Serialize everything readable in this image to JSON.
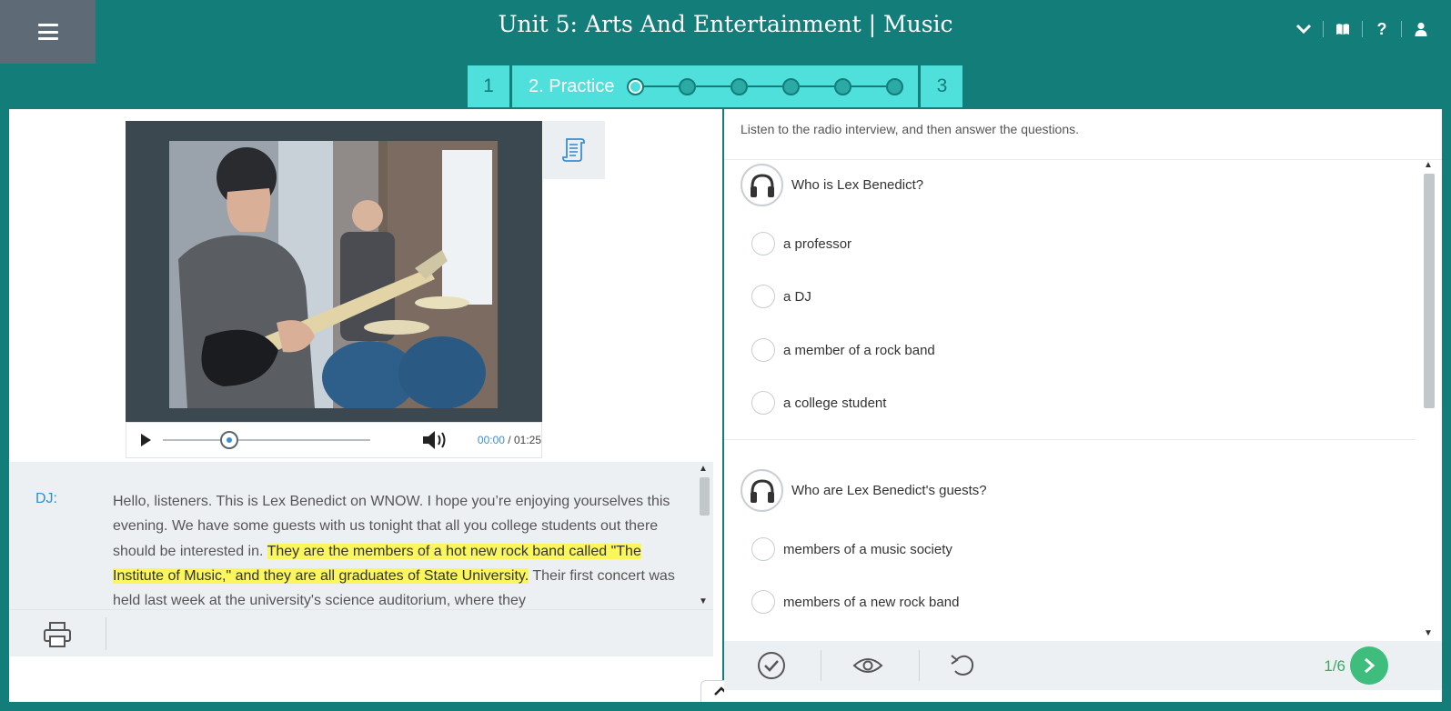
{
  "header": {
    "title": "Unit 5: Arts And Entertainment | Music",
    "icons": [
      "menu-icon",
      "chevron-down-icon",
      "book-icon",
      "help-icon",
      "user-icon"
    ],
    "help_glyph": "?"
  },
  "steps": {
    "first": "1",
    "active_label": "2. Practice",
    "last": "3",
    "dot_count": 6,
    "current_dot": 1
  },
  "media": {
    "time_current": "00:00",
    "time_separator": "/",
    "time_total": "01:25",
    "progress_fraction": 0.32
  },
  "transcript": {
    "speaker": "DJ:",
    "text_before": "Hello, listeners. This is Lex Benedict on WNOW. I hope you’re enjoying yourselves this evening. We have some guests with us tonight that all you college students out there should be interested in. ",
    "text_highlight": "They are the members of a hot new rock band called \"The Institute of Music,\" and they are all graduates of State University.",
    "text_after": " Their first concert was held last week at the university's science auditorium, where they"
  },
  "activity": {
    "instruction": "Listen to the radio interview, and then answer the questions.",
    "questions": [
      {
        "text": "Who is Lex Benedict?",
        "options": [
          "a professor",
          "a DJ",
          "a member of a rock band",
          "a college student"
        ]
      },
      {
        "text": "Who are Lex Benedict's guests?",
        "options": [
          "members of a music society",
          "members of a new rock band"
        ]
      }
    ],
    "page_indicator": "1/6"
  },
  "colors": {
    "header_teal": "#137d7a",
    "step_cyan": "#4fe0dc",
    "menu_gray": "#5e6a75",
    "highlight_yellow": "#fbf65c",
    "next_green": "#3ebd7c",
    "speaker_blue": "#2f8fc8"
  }
}
